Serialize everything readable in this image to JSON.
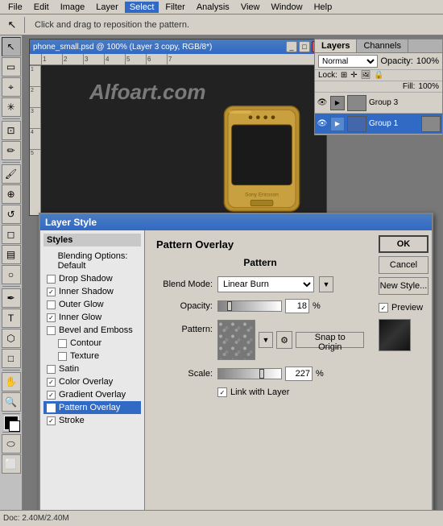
{
  "menubar": {
    "items": [
      "File",
      "Edit",
      "Image",
      "Layer",
      "Select",
      "Filter",
      "Analysis",
      "View",
      "Window",
      "Help"
    ]
  },
  "toolbar": {
    "status_text": "Click and drag to reposition the pattern.",
    "tool_icon": "↖"
  },
  "doc": {
    "title": "phone_small.psd @ 100% (Layer 3 copy, RGB/8*)",
    "watermark": "Alfoart.com",
    "ruler_h_marks": [
      "1",
      "2",
      "3",
      "4",
      "5"
    ],
    "ruler_v_marks": [
      "1",
      "2",
      "3",
      "4",
      "5"
    ]
  },
  "layers": {
    "tab_layers": "Layers",
    "tab_channels": "Channels",
    "blend_mode": "Normal",
    "opacity_label": "Opacity:",
    "opacity_value": "100%",
    "lock_label": "Lock:",
    "fill_label": "Fill:",
    "fill_value": "100%",
    "items": [
      {
        "name": "Group 3",
        "visible": true,
        "type": "group",
        "selected": false
      },
      {
        "name": "Group 1",
        "visible": true,
        "type": "group",
        "selected": true
      }
    ]
  },
  "dialog": {
    "title": "Layer Style",
    "styles_header": "Styles",
    "style_items": [
      {
        "label": "Blending Options: Default",
        "checked": false,
        "active": false
      },
      {
        "label": "Drop Shadow",
        "checked": false,
        "active": false
      },
      {
        "label": "Inner Shadow",
        "checked": true,
        "active": false
      },
      {
        "label": "Outer Glow",
        "checked": false,
        "active": false
      },
      {
        "label": "Inner Glow",
        "checked": true,
        "active": false
      },
      {
        "label": "Bevel and Emboss",
        "checked": false,
        "active": false
      },
      {
        "label": "Contour",
        "checked": false,
        "active": false,
        "indent": true
      },
      {
        "label": "Texture",
        "checked": false,
        "active": false,
        "indent": true
      },
      {
        "label": "Satin",
        "checked": false,
        "active": false
      },
      {
        "label": "Color Overlay",
        "checked": true,
        "active": false
      },
      {
        "label": "Gradient Overlay",
        "checked": true,
        "active": false
      },
      {
        "label": "Pattern Overlay",
        "checked": true,
        "active": true
      },
      {
        "label": "Stroke",
        "checked": true,
        "active": false
      }
    ],
    "panel_title": "Pattern Overlay",
    "panel_subtitle": "Pattern",
    "blend_mode_label": "Blend Mode:",
    "blend_mode_value": "Linear Burn",
    "opacity_label": "Opacity:",
    "opacity_value": "18",
    "opacity_pct": "%",
    "pattern_label": "Pattern:",
    "snap_btn_label": "Snap to Origin",
    "scale_label": "Scale:",
    "scale_value": "227",
    "scale_pct": "%",
    "link_layer_label": "Link with Layer",
    "link_layer_checked": true,
    "ok_label": "OK",
    "cancel_label": "Cancel",
    "new_style_label": "New Style...",
    "preview_label": "Preview",
    "preview_checked": true
  }
}
